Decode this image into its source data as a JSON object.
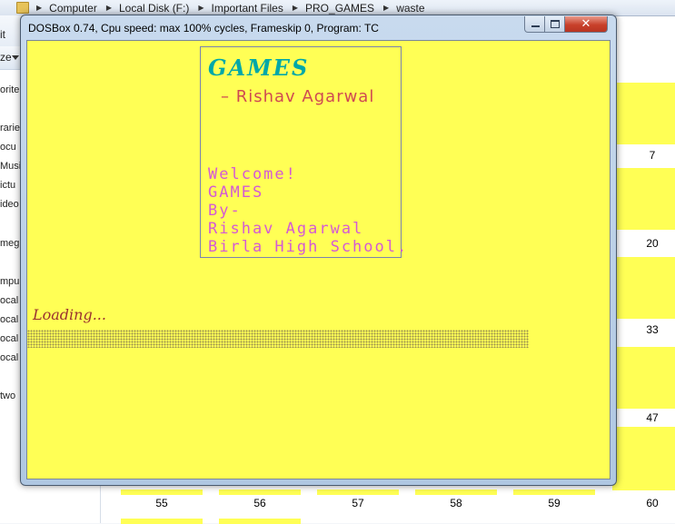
{
  "explorer": {
    "breadcrumb": [
      "Computer",
      "Local Disk (F:)",
      "Important Files",
      "PRO_GAMES",
      "waste"
    ],
    "menu_fragment": "it",
    "organize_fragment": "ze",
    "nav_items": [
      "orite",
      "rarie",
      "ocu",
      "Musi",
      "ictu",
      "ideo",
      "meg",
      "mpu",
      "ocal",
      "ocal",
      "ocal",
      "ocal",
      "two"
    ],
    "page_numbers": [
      "7",
      "20",
      "33",
      "47",
      "55",
      "56",
      "57",
      "58",
      "59",
      "60"
    ]
  },
  "dosbox": {
    "title": "DOSBox 0.74, Cpu speed: max 100% cycles, Frameskip  0, Program:     TC",
    "controls": {
      "close_glyph": "✕"
    },
    "screen": {
      "logo": "GAMES",
      "author": "– Rishav Agarwal",
      "welcome_lines": [
        "Welcome!",
        "GAMES",
        "By-",
        "Rishav Agarwal",
        "Birla High School."
      ],
      "loading": "Loading..."
    }
  },
  "colors": {
    "dos_background": "#ffff55",
    "logo": "#00a8a8",
    "author": "#cf4a52",
    "welcome": "#d45ad4",
    "loading": "#9a3030"
  }
}
